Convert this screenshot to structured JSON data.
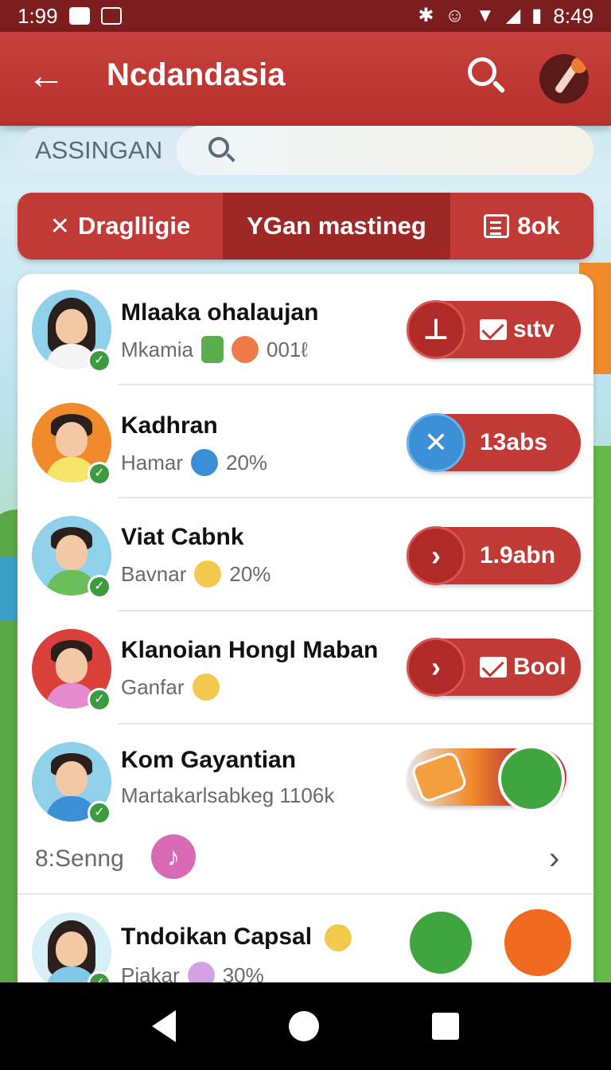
{
  "status_bar": {
    "time_left": "1:99",
    "time_right": "8:49",
    "icons_left": [
      "notification-icon",
      "image-icon"
    ],
    "icons_right": [
      "bluetooth-icon",
      "alarm-icon",
      "wifi-icon",
      "signal-icon",
      "battery-icon"
    ]
  },
  "app_bar": {
    "title": "Ncdandasia",
    "back_icon": "arrow-left-icon",
    "search_icon": "search-icon",
    "avatar_icon": "pen-avatar-icon"
  },
  "search": {
    "chip_label": "ASSINGAN",
    "placeholder": ""
  },
  "tabs": [
    {
      "label": "Draglligie",
      "icon": "cross-arrows-icon"
    },
    {
      "label": "YGan mastineg",
      "icon": ""
    },
    {
      "label": "8ok",
      "icon": "document-icon"
    }
  ],
  "items": [
    {
      "name": "Mlaaka ohalaujan",
      "sub": "Mkamia",
      "stat": "001ℓ",
      "action_label": "sɩtv",
      "action_icon": "download-icon",
      "action_label_icon": "mail-icon"
    },
    {
      "name": "Kadhran",
      "sub": "Hamar",
      "stat": "20%",
      "action_label": "13abs",
      "action_icon": "close-icon"
    },
    {
      "name": "Viat Cabnk",
      "sub": "Bavnar",
      "stat": "20%",
      "action_label": "1.9abn",
      "action_icon": "chevron-right-icon"
    },
    {
      "name": "Klanoian Hongl Maban",
      "sub": "Ganfar",
      "stat": "",
      "action_label": "Bool",
      "action_icon": "chevron-right-icon",
      "action_label_icon": "mail-icon"
    },
    {
      "name": "Kom Gayantian",
      "sub": "Martakarlsabkeg 1106k",
      "stat": ""
    },
    {
      "name": "Tndoikan Capsal",
      "sub": "Piakar",
      "stat": "30%"
    }
  ],
  "song_row": {
    "label": "8:Senng",
    "icon": "music-note-icon"
  },
  "colors": {
    "app_bar": "#c23a35",
    "status_bar": "#7c1e1e",
    "tab_active": "#9e2826",
    "verified": "#3e9a3e"
  }
}
